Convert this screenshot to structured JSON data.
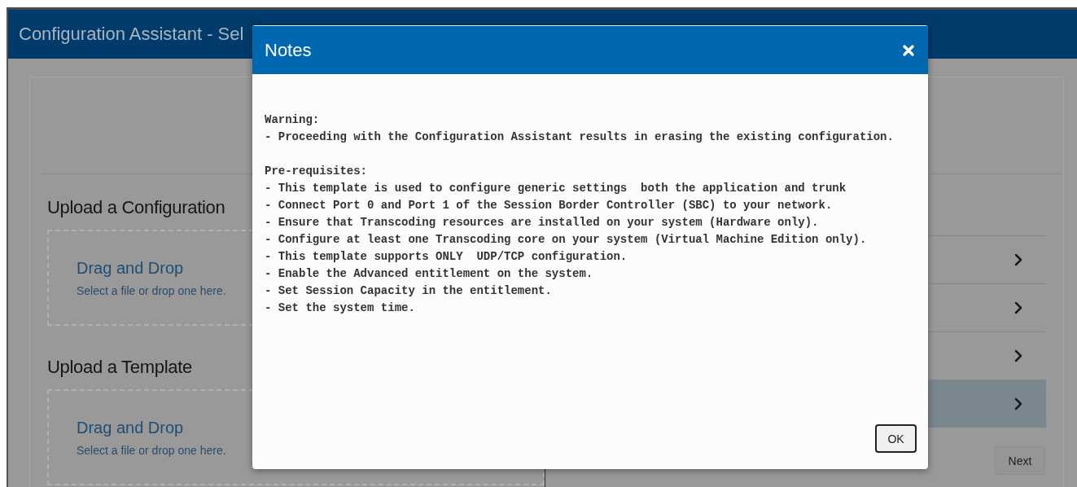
{
  "header": {
    "title": "Configuration Assistant - Sel"
  },
  "upload_sections": [
    {
      "heading": "Upload a Configuration",
      "drop_title": "Drag and Drop",
      "drop_hint": "Select a file or drop one here."
    },
    {
      "heading": "Upload a Template",
      "drop_title": "Drag and Drop",
      "drop_hint": "Select a file or drop one here."
    }
  ],
  "steps": [
    {
      "selected": false
    },
    {
      "selected": false
    },
    {
      "selected": false
    },
    {
      "selected": true
    }
  ],
  "next_button": "Next",
  "dialog": {
    "title": "Notes",
    "ok_button": "OK",
    "blocks": [
      {
        "heading": "Warning:",
        "items": [
          "- Proceeding with the Configuration Assistant results in erasing the existing configuration."
        ]
      },
      {
        "heading": "Pre-requisites:",
        "items": [
          "- This template is used to configure generic settings  both the application and trunk",
          "- Connect Port 0 and Port 1 of the Session Border Controller (SBC) to your network.",
          "- Ensure that Transcoding resources are installed on your system (Hardware only).",
          "- Configure at least one Transcoding core on your system (Virtual Machine Edition only).",
          "- This template supports ONLY  UDP/TCP configuration.",
          "- Enable the Advanced entitlement on the system.",
          "- Set Session Capacity in the entitlement.",
          "- Set the system time."
        ]
      }
    ]
  }
}
